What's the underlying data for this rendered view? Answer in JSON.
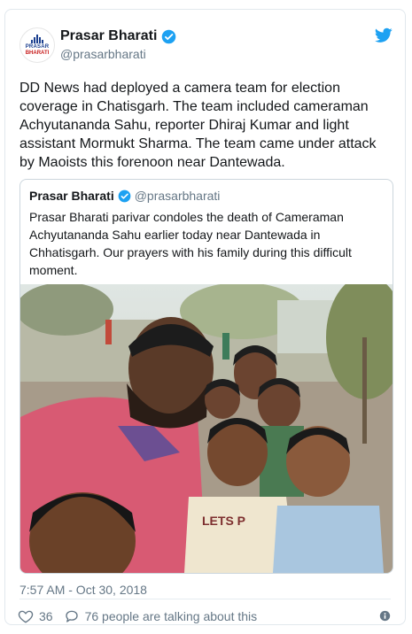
{
  "tweet": {
    "author": {
      "display_name": "Prasar Bharati",
      "handle": "@prasarbharati",
      "logo_text_top": "PRASAR",
      "logo_text_bottom": "BHARATI"
    },
    "text": "DD News had deployed a camera team for election coverage in Chatisgarh. The team included cameraman Achyutananda Sahu, reporter Dhiraj Kumar and light assistant Mormukt Sharma. The team came under attack by Maoists this forenoon near Dantewada.",
    "timestamp": "7:57 AM - Oct 30, 2018",
    "likes": "36",
    "talking": "76 people are talking about this"
  },
  "quoted": {
    "display_name": "Prasar Bharati",
    "handle": "@prasarbharati",
    "text": "Prasar Bharati parivar condoles the death of Cameraman Achyutananda Sahu earlier today near Dantewada in Chhatisgarh. Our prayers with his family during this difficult moment.",
    "photo_subject": "Selfie of a man with a group of boys outdoors"
  },
  "colors": {
    "twitter_blue": "#1da1f2",
    "text": "#14171a",
    "muted": "#657786",
    "border": "#e1e8ed"
  },
  "icons": [
    "verified-icon",
    "twitter-bird-icon",
    "heart-icon",
    "reply-bubble-icon",
    "info-icon"
  ]
}
